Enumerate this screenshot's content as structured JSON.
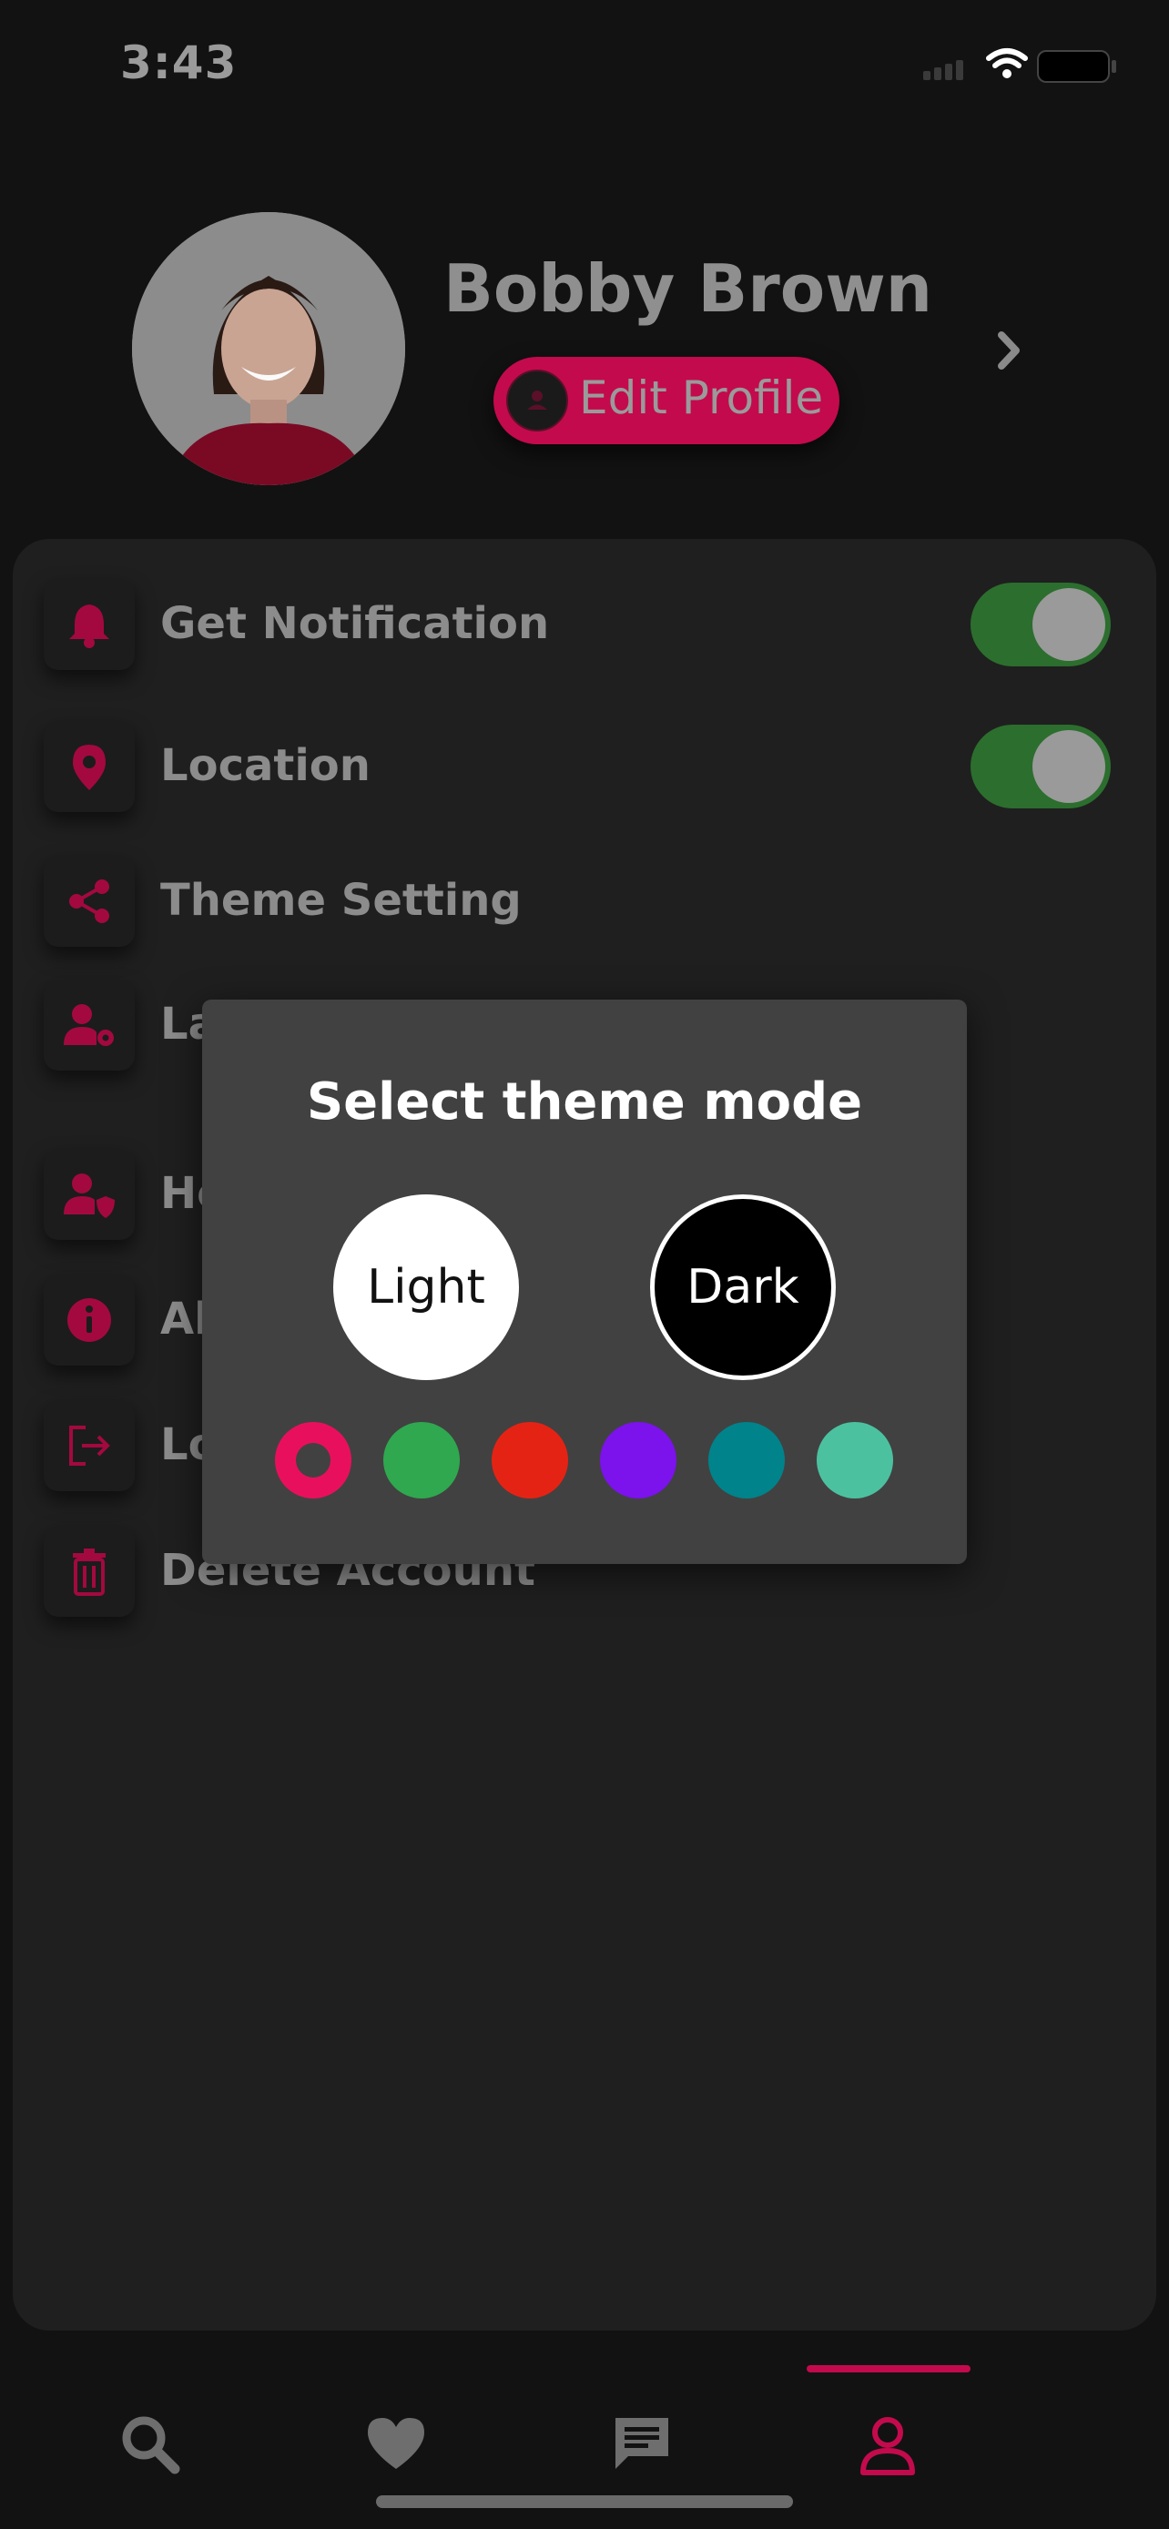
{
  "status_bar": {
    "time": "3:43",
    "icons": [
      "cellular-icon",
      "wifi-icon",
      "battery-icon"
    ]
  },
  "profile": {
    "name": "Bobby Brown",
    "edit_label": "Edit Profile",
    "icons": [
      "avatar-photo",
      "user-icon",
      "chevron-right-icon"
    ]
  },
  "settings": {
    "items": [
      {
        "label": "Get Notification",
        "icon": "bell-icon",
        "toggle": true
      },
      {
        "label": "Location",
        "icon": "location-pin-icon",
        "toggle": true
      },
      {
        "label": "Theme Setting",
        "icon": "share-icon"
      },
      {
        "label": "La",
        "icon": "user-gear-icon"
      },
      {
        "label": "He",
        "icon": "user-shield-icon"
      },
      {
        "label": "Al",
        "icon": "info-icon"
      },
      {
        "label": "Lo",
        "icon": "logout-icon"
      },
      {
        "label": "Delete Account",
        "icon": "trash-icon"
      }
    ]
  },
  "theme_modal": {
    "title": "Select theme mode",
    "light_label": "Light",
    "dark_label": "Dark",
    "swatches": [
      "#e8105c",
      "#2fa84f",
      "#e52314",
      "#7c12ec",
      "#00838a",
      "#4cc1a0"
    ],
    "selected_swatch": 0
  },
  "bottom_nav": {
    "items": [
      "search-icon",
      "heart-icon",
      "message-icon",
      "profile-icon"
    ],
    "active": 3
  },
  "colors": {
    "accent": "#c30a4c",
    "toggle_on": "#2c6e2e",
    "background": "#121212",
    "card": "#1f1f1f",
    "modal": "#414141"
  }
}
